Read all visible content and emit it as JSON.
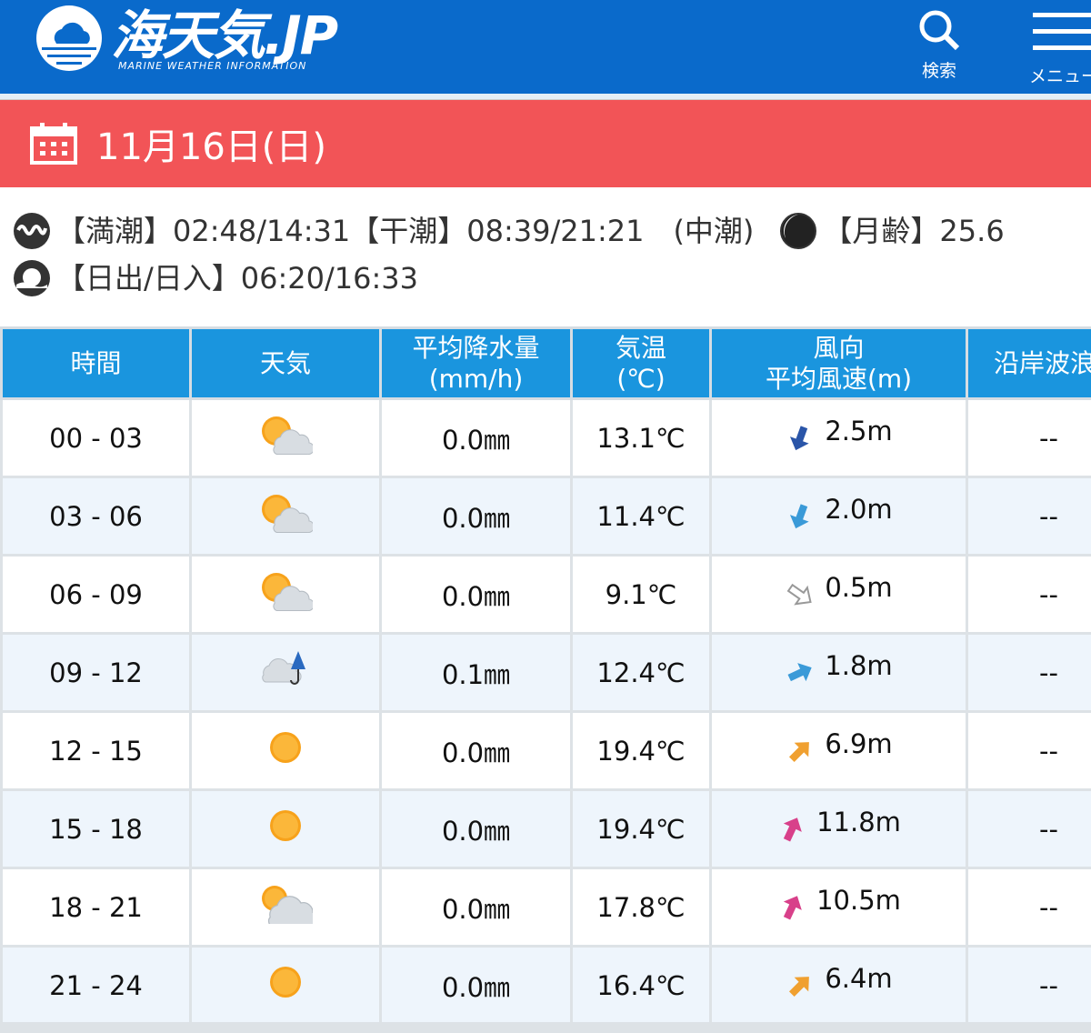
{
  "header": {
    "logo_title": "海天気.JP",
    "logo_subtitle": "MARINE WEATHER INFORMATION",
    "search_label": "検索",
    "menu_label": "メニュー",
    "color": "#0a6acb"
  },
  "date": {
    "label": "11月16日(日)",
    "color": "#f25457"
  },
  "info": {
    "tide": "【満潮】02:48/14:31【干潮】08:39/21:21　(中潮)",
    "moon": "【月齢】25.6",
    "sun": "【日出/日入】06:20/16:33"
  },
  "table": {
    "headers": [
      "時間",
      "天気",
      "平均降水量\n(mm/h)",
      "気温\n(℃)",
      "風向\n平均風速(m)",
      "沿岸波浪"
    ],
    "rows": [
      {
        "time": "00 - 03",
        "weather": "sun-cloud-icon",
        "rain": "0.0㎜",
        "temp": "13.1℃",
        "wind": "2.5m",
        "dir": 200,
        "color": "#2a55a8",
        "wave": "--"
      },
      {
        "time": "03 - 06",
        "weather": "sun-cloud-icon",
        "rain": "0.0㎜",
        "temp": "11.4℃",
        "wind": "2.0m",
        "dir": 200,
        "color": "#3a9ad8",
        "wave": "--"
      },
      {
        "time": "06 - 09",
        "weather": "sun-cloud-icon",
        "rain": "0.0㎜",
        "temp": "9.1℃",
        "wind": "0.5m",
        "dir": 125,
        "color": "#ffffff",
        "wave": "--"
      },
      {
        "time": "09 - 12",
        "weather": "cloud-rain-icon",
        "rain": "0.1㎜",
        "temp": "12.4℃",
        "wind": "1.8m",
        "dir": 65,
        "color": "#3a9ad8",
        "wave": "--"
      },
      {
        "time": "12 - 15",
        "weather": "sun-icon",
        "rain": "0.0㎜",
        "temp": "19.4℃",
        "wind": "6.9m",
        "dir": 45,
        "color": "#f0a030",
        "wave": "--"
      },
      {
        "time": "15 - 18",
        "weather": "sun-icon",
        "rain": "0.0㎜",
        "temp": "19.4℃",
        "wind": "11.8m",
        "dir": 25,
        "color": "#d8408a",
        "wave": "--"
      },
      {
        "time": "18 - 21",
        "weather": "cloud-sun-icon",
        "rain": "0.0㎜",
        "temp": "17.8℃",
        "wind": "10.5m",
        "dir": 25,
        "color": "#d8408a",
        "wave": "--"
      },
      {
        "time": "21 - 24",
        "weather": "sun-icon",
        "rain": "0.0㎜",
        "temp": "16.4℃",
        "wind": "6.4m",
        "dir": 45,
        "color": "#f0a030",
        "wave": "--"
      }
    ]
  }
}
